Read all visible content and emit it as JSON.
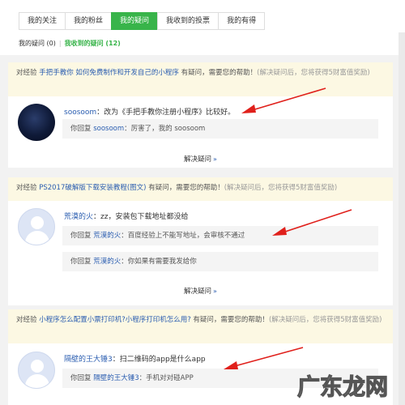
{
  "tabs": [
    "我的关注",
    "我的粉丝",
    "我的疑问",
    "我收到的投票",
    "我的有得"
  ],
  "active_tab": 2,
  "subtabs": {
    "asked": "我的疑问 (0)",
    "sep": "|",
    "received": "我收到的疑问 (12)"
  },
  "cards": [
    {
      "prefix": "对经验 ",
      "title": "手把手教你 如何免费制作和开发自己的小程序",
      "suffix": " 有疑问，需要您的帮助！",
      "hint": "(解决疑问后，您将获得5财富值奖励)",
      "question_user": "soosoom",
      "question_text": "：改为《手把手教你注册小程序》比较好。",
      "replies": [
        {
          "prefix": "你回复 ",
          "user": "soosoom",
          "text": "：厉害了，我的 soosoom"
        }
      ],
      "resolve": "解决疑问",
      "chevron": "»"
    },
    {
      "prefix": "对经验 ",
      "title": "PS2017破解版下载安装教程(图文)",
      "suffix": " 有疑问，需要您的帮助！",
      "hint": "(解决疑问后，您将获得5财富值奖励)",
      "question_user": "荒漠的火",
      "question_text": "：zz，安装包下载地址都没给",
      "replies": [
        {
          "prefix": "你回复 ",
          "user": "荒漠的火",
          "text": "：百度经验上不能写地址，会审核不通过"
        },
        {
          "prefix": "你回复 ",
          "user": "荒漠的火",
          "text": "：你如果有需要我发给你"
        }
      ],
      "resolve": "解决疑问",
      "chevron": "»"
    },
    {
      "prefix": "对经验 ",
      "title": "小程序怎么配置小票打印机?小程序打印机怎么用?",
      "suffix": " 有疑问，需要您的帮助！",
      "hint": "(解决疑问后，您将获得5财富值奖励)",
      "question_user": "隔壁的王大锤3",
      "question_text": "：扫二维码的app是什么app",
      "replies": [
        {
          "prefix": "你回复 ",
          "user": "隔壁的王大锤3",
          "text": "：手机对对碰APP"
        }
      ]
    }
  ],
  "watermark": "广东龙网",
  "colors": {
    "accent_green": "#38b44a",
    "link_blue": "#2a5db0",
    "arrow_red": "#e0201b",
    "notice_bg": "#fcf8e3"
  }
}
